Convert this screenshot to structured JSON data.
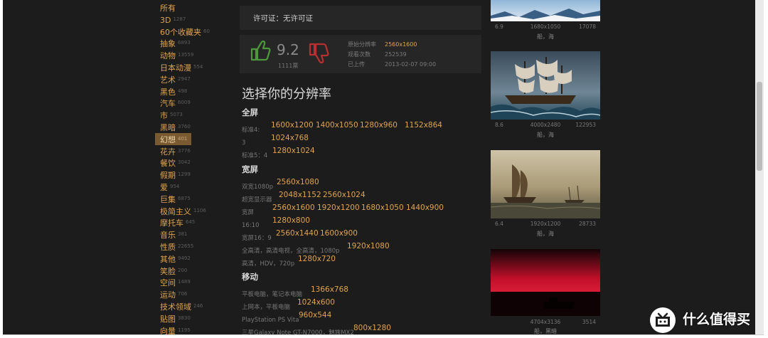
{
  "sidebar": {
    "categories": [
      {
        "name": "所有",
        "count": ""
      },
      {
        "name": "3D",
        "count": "1287"
      },
      {
        "name": "60个收藏夹",
        "count": "60"
      },
      {
        "name": "抽象",
        "count": "6893"
      },
      {
        "name": "动物",
        "count": "13559"
      },
      {
        "name": "日本动漫",
        "count": "554"
      },
      {
        "name": "艺术",
        "count": "2947"
      },
      {
        "name": "黑色",
        "count": "498"
      },
      {
        "name": "汽车",
        "count": "6009"
      },
      {
        "name": "市",
        "count": "5073"
      },
      {
        "name": "黑暗",
        "count": "3760"
      },
      {
        "name": "幻想",
        "count": "401"
      },
      {
        "name": "花卉",
        "count": "3776"
      },
      {
        "name": "餐饮",
        "count": "3042"
      },
      {
        "name": "假期",
        "count": "1299"
      },
      {
        "name": "爱",
        "count": "954"
      },
      {
        "name": "巨集",
        "count": "6875"
      },
      {
        "name": "极简主义",
        "count": "1106"
      },
      {
        "name": "摩托车",
        "count": "645"
      },
      {
        "name": "音乐",
        "count": "381"
      },
      {
        "name": "性质",
        "count": "22655"
      },
      {
        "name": "其他",
        "count": "9492"
      },
      {
        "name": "笑脸",
        "count": "200"
      },
      {
        "name": "空间",
        "count": "1489"
      },
      {
        "name": "运动",
        "count": "706"
      },
      {
        "name": "技术领域",
        "count": "246"
      },
      {
        "name": "贴图",
        "count": "3830"
      },
      {
        "name": "向量",
        "count": "1195"
      }
    ],
    "active": "幻想"
  },
  "license": {
    "text": "许可证：无许可证"
  },
  "rating": {
    "score": "9.2",
    "votes": "1111票"
  },
  "meta": {
    "rows": [
      {
        "key": "原始分辨率",
        "value": "2560x1600"
      },
      {
        "key": "观看次数",
        "value": "252539"
      },
      {
        "key": "已上传",
        "value": "2013-02-07 09:00"
      }
    ]
  },
  "resolutions": {
    "title": "选择你的分辨率",
    "sections": [
      {
        "name": "全屏",
        "rows": [
          {
            "label": "标准4:",
            "items": [
              "1600x1200",
              "1400x1050",
              "1280x960",
              "1152x864"
            ]
          },
          {
            "label": "3",
            "items": [
              "1024x768"
            ]
          },
          {
            "label": "标准5：4",
            "items": [
              "1280x1024"
            ]
          }
        ]
      },
      {
        "name": "宽屏",
        "rows": [
          {
            "label": "双宽1080p",
            "items": [
              "2560x1080"
            ]
          },
          {
            "label": "超宽显示器",
            "items": [
              "2048x1152",
              "2560x1024"
            ]
          },
          {
            "label": "宽屏",
            "items": [
              "2560x1600",
              "1920x1200",
              "1680x1050",
              "1440x900"
            ]
          },
          {
            "label": "16:10",
            "items": [
              "1280x800"
            ]
          },
          {
            "label": "宽屏16：9",
            "items": [
              "2560x1440",
              "1600x900"
            ]
          },
          {
            "label": "全高清，高清电视，全高清，1080p",
            "items": [
              "1920x1080"
            ]
          },
          {
            "label": "高清，HDV，720p",
            "items": [
              "1280x720"
            ]
          }
        ]
      },
      {
        "name": "移动",
        "rows": [
          {
            "label": "平板电脑，笔记本电脑",
            "items": [
              "1366x768"
            ]
          },
          {
            "label": "上网本，平板电脑",
            "items": [
              "1024x600"
            ]
          },
          {
            "label": "PlayStation PS Vita",
            "items": [
              "960x544"
            ]
          },
          {
            "label": "三星Galaxy Note GT-N7000，魅族MX2",
            "items": [
              "800x1280"
            ]
          }
        ]
      }
    ]
  },
  "related": [
    {
      "rating": "6.9",
      "size": "1680x1050",
      "views": "17078",
      "tags": "船，海"
    },
    {
      "rating": "8.6",
      "size": "4000x2480",
      "views": "122953",
      "tags": "船，海"
    },
    {
      "rating": "6.4",
      "size": "1920x1200",
      "views": "28733",
      "tags": "船，海"
    },
    {
      "rating": "",
      "size": "4704x3136",
      "views": "3514",
      "tags": "船，黑暗"
    }
  ],
  "watermark": {
    "text": "什么值得买"
  },
  "colors": {
    "accent": "#e0a44c",
    "bg": "#1c1c1c",
    "panel": "#262626",
    "up": "#4a9a3a",
    "down": "#b83030"
  }
}
